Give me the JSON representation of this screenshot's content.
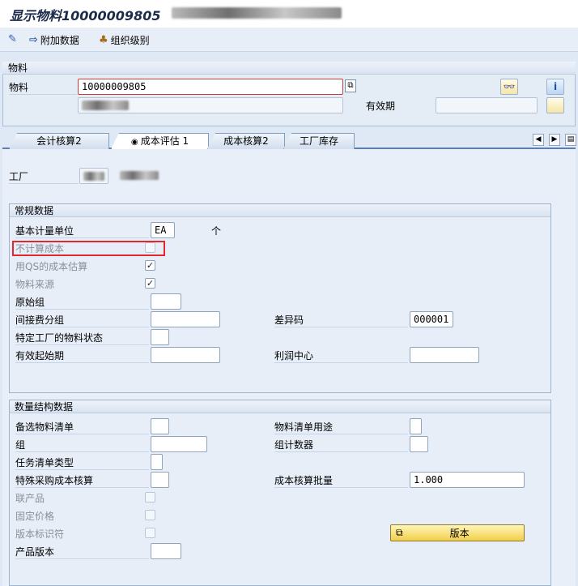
{
  "window": {
    "title": "显示物料10000009805"
  },
  "toolbar": {
    "additional_data": "附加数据",
    "org_levels": "组织级别"
  },
  "header": {
    "group_title": "物料",
    "material_label": "物料",
    "material_value": "10000009805",
    "validity_label": "有效期"
  },
  "tabs": [
    {
      "label": "会计核算2"
    },
    {
      "label": "成本评估 1"
    },
    {
      "label": "成本核算2"
    },
    {
      "label": "工厂库存"
    }
  ],
  "plant": {
    "label": "工厂"
  },
  "general": {
    "title": "常规数据",
    "base_uom_label": "基本计量单位",
    "base_uom_value": "EA",
    "base_uom_text": "个",
    "no_costing_label": "不计算成本",
    "qs_label": "用QS的成本估算",
    "origin_label": "物料来源",
    "origin_group_label": "原始组",
    "overhead_label": "间接费分组",
    "variance_label": "差异码",
    "variance_value": "000001",
    "plant_status_label": "特定工厂的物料状态",
    "valid_from_label": "有效起始期",
    "profit_center_label": "利润中心"
  },
  "quantity": {
    "title": "数量结构数据",
    "alt_bom_label": "备选物料清单",
    "bom_usage_label": "物料清单用途",
    "group_label": "组",
    "group_counter_label": "组计数器",
    "task_list_type_label": "任务清单类型",
    "special_proc_label": "特殊采购成本核算",
    "lot_size_label": "成本核算批量",
    "lot_size_value": "1.000",
    "co_product_label": "联产品",
    "fixed_price_label": "固定价格",
    "version_ind_label": "版本标识符",
    "production_version_label": "产品版本",
    "versions_button": "版本"
  },
  "colors": {
    "highlight_red": "#e0282d",
    "panel_bg": "#e7eef8"
  }
}
